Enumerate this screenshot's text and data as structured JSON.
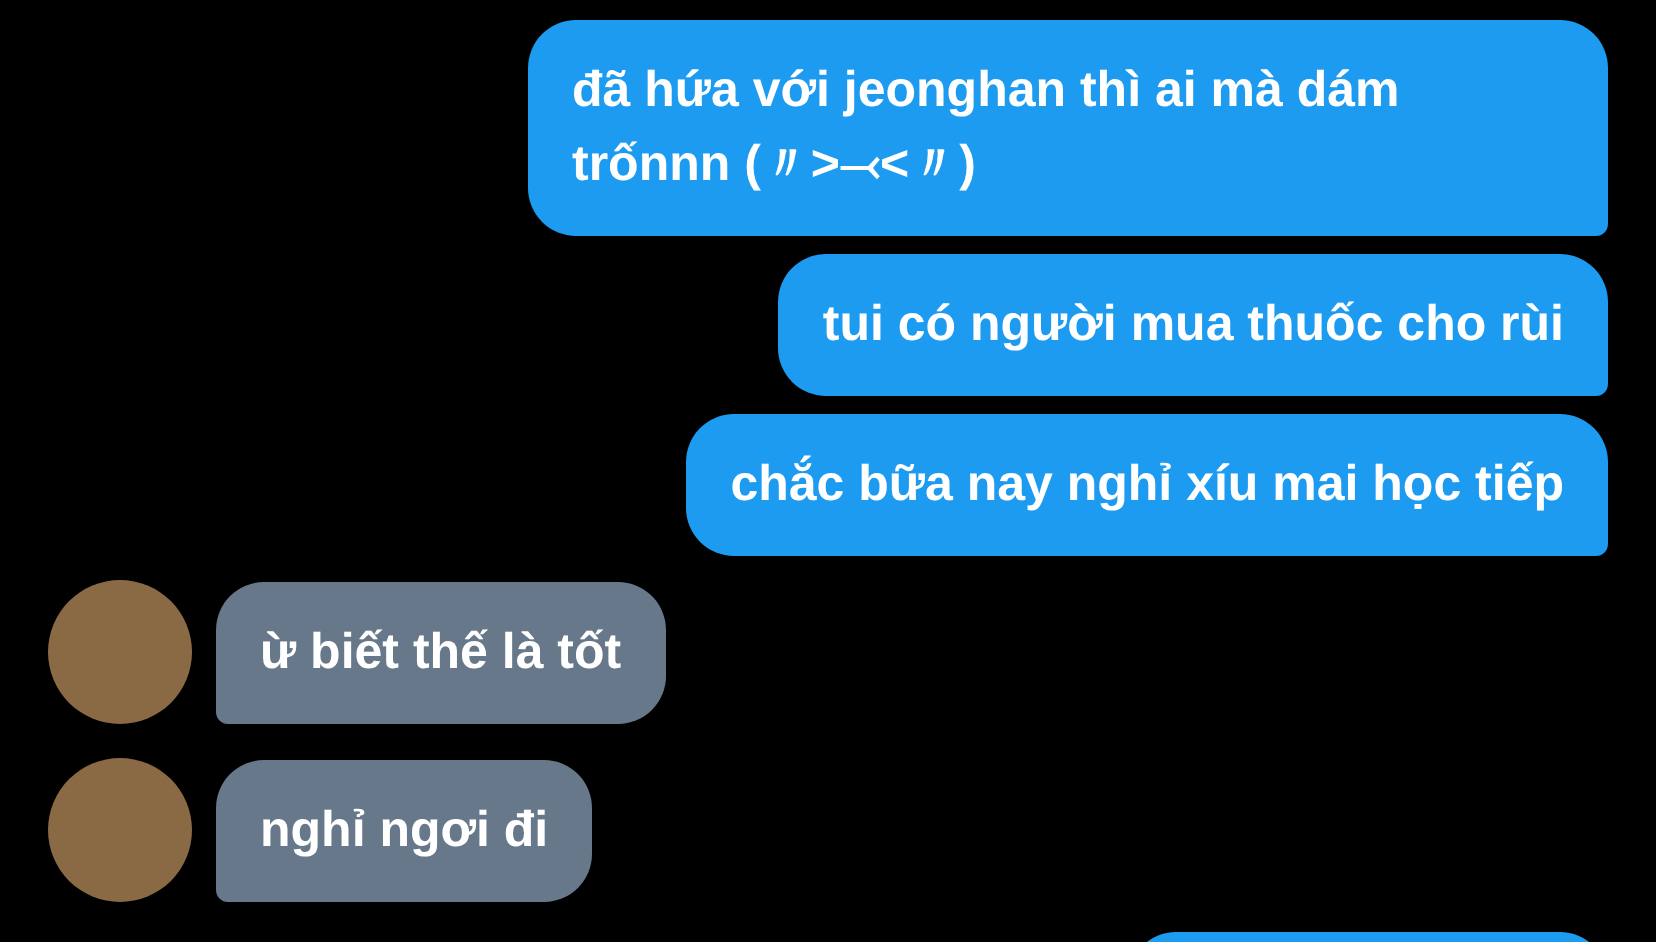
{
  "messages": [
    {
      "kind": "outgoing",
      "text": "đã hứa với jeonghan thì ai mà dám trốnnn (〃>⤙<〃)"
    },
    {
      "kind": "outgoing",
      "text": "tui có người mua thuốc cho rùi"
    },
    {
      "kind": "outgoing",
      "text": "chắc bữa nay nghỉ xíu mai học tiếp"
    },
    {
      "kind": "incoming",
      "text": "ừ biết thế là tốt"
    },
    {
      "kind": "incoming",
      "text": "nghỉ ngơi đi"
    },
    {
      "kind": "outgoing"
    }
  ]
}
